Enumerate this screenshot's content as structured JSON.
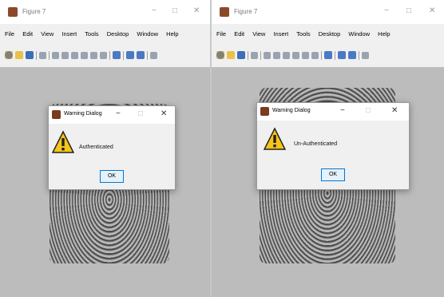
{
  "figures": [
    {
      "title": "Figure 7",
      "menu": [
        "File",
        "Edit",
        "View",
        "Insert",
        "Tools",
        "Desktop",
        "Window",
        "Help"
      ],
      "dialog": {
        "title": "Warning Dialog",
        "message": "Authenticated",
        "ok_label": "OK"
      }
    },
    {
      "title": "Figure 7",
      "menu": [
        "File",
        "Edit",
        "View",
        "Insert",
        "Tools",
        "Desktop",
        "Window",
        "Help"
      ],
      "dialog": {
        "title": "Warning Dialog",
        "message": "Un-Authenticated",
        "ok_label": "OK"
      }
    }
  ],
  "window_controls": {
    "minimize": "−",
    "maximize": "□",
    "close": "✕"
  },
  "colors": {
    "warning_yellow": "#f5c518",
    "ok_border": "#0078d7",
    "canvas_grey": "#bcbcbc"
  },
  "icons": [
    "figure-icon",
    "warning-icon",
    "toolbar-icons"
  ]
}
